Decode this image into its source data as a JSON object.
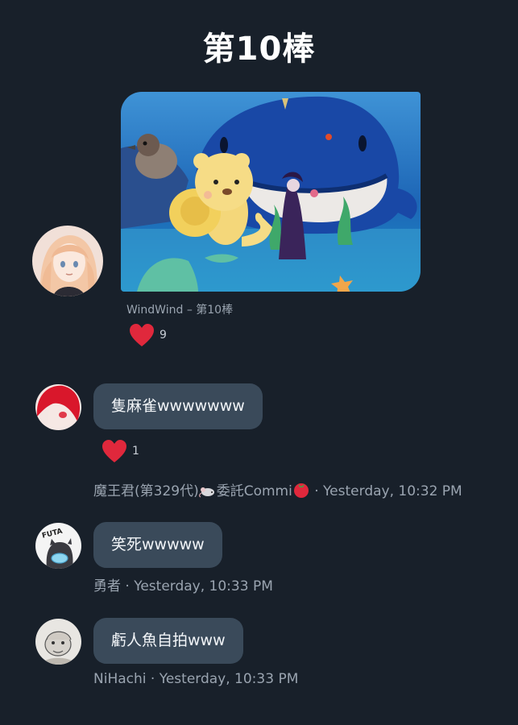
{
  "page": {
    "title": "第10棒"
  },
  "post": {
    "caption": "WindWind – 第10棒",
    "reactions": {
      "count": "9"
    }
  },
  "comments": [
    {
      "text": "隻麻雀wwwwwww",
      "author": "魔王君(第329代)",
      "author_suffix": "委託Commi",
      "time": " · Yesterday, 10:32 PM",
      "reactions": {
        "count": "1"
      },
      "emoji": [
        "mouse-icon",
        "tomato-icon"
      ]
    },
    {
      "text": "笑死wwwww",
      "author": "勇者",
      "time": " · Yesterday, 10:33 PM"
    },
    {
      "text": "虧人魚自拍www",
      "author": "NiHachi",
      "time": " · Yesterday, 10:33 PM"
    }
  ],
  "colors": {
    "background": "#18202a",
    "bubble": "#3a4a5a",
    "heart": "#e0283c",
    "muted_text": "#9aa4b0"
  }
}
